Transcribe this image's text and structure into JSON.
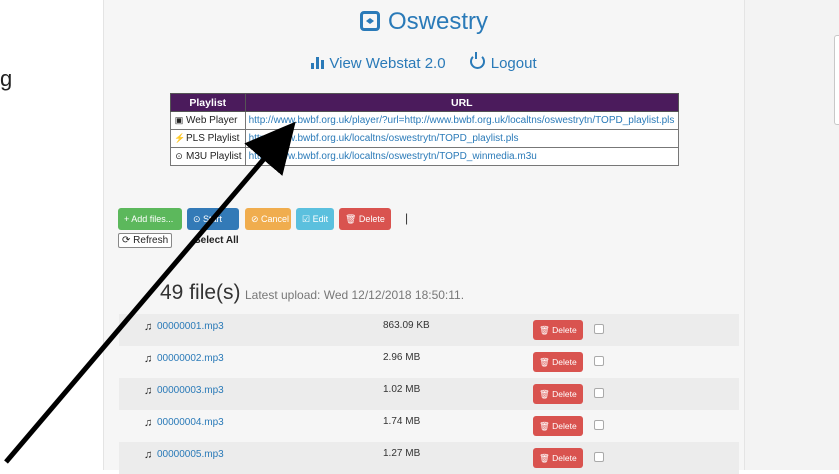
{
  "left_fragment": "g",
  "site": {
    "title": "Oswestry"
  },
  "nav": {
    "webstat": "View Webstat 2.0",
    "logout": "Logout"
  },
  "playlists": {
    "headers": [
      "Playlist",
      "URL"
    ],
    "rows": [
      {
        "icon": "play-square-icon",
        "sym": "▣",
        "type": "Web Player",
        "url": "http://www.bwbf.org.uk/player/?url=http://www.bwbf.org.uk/localtns/oswestrytn/TOPD_playlist.pls"
      },
      {
        "icon": "bolt-icon",
        "sym": "⚡",
        "type": "PLS Playlist",
        "url": "http://www.bwbf.org.uk/localtns/oswestrytn/TOPD_playlist.pls"
      },
      {
        "icon": "play-circle-icon",
        "sym": "⊙",
        "type": "M3U Playlist",
        "url": "http://www.bwbf.org.uk/localtns/oswestrytn/TOPD_winmedia.m3u"
      }
    ]
  },
  "toolbar": {
    "add": "+ Add files...",
    "start": "⊙ Start",
    "cancel": "⊘ Cancel",
    "edit": "☑ Edit",
    "delete": "🗑 Delete",
    "sep": "|",
    "refresh": "⟳ Refresh",
    "select_all": "Select All",
    "colors": {
      "add": "#5cb85c",
      "start": "#337ab7",
      "cancel": "#f0ad4e",
      "edit": "#5bc0de",
      "delete": "#d9534f"
    }
  },
  "summary": {
    "count": "49 file(s)",
    "latest": "Latest upload: Wed 12/12/2018 18:50:11."
  },
  "files": [
    {
      "name": "00000001.mp3",
      "size": "863.09 KB",
      "delete": "🗑 Delete"
    },
    {
      "name": "00000002.mp3",
      "size": "2.96 MB",
      "delete": "🗑 Delete"
    },
    {
      "name": "00000003.mp3",
      "size": "1.02 MB",
      "delete": "🗑 Delete"
    },
    {
      "name": "00000004.mp3",
      "size": "1.74 MB",
      "delete": "🗑 Delete"
    },
    {
      "name": "00000005.mp3",
      "size": "1.27 MB",
      "delete": "🗑 Delete"
    }
  ]
}
